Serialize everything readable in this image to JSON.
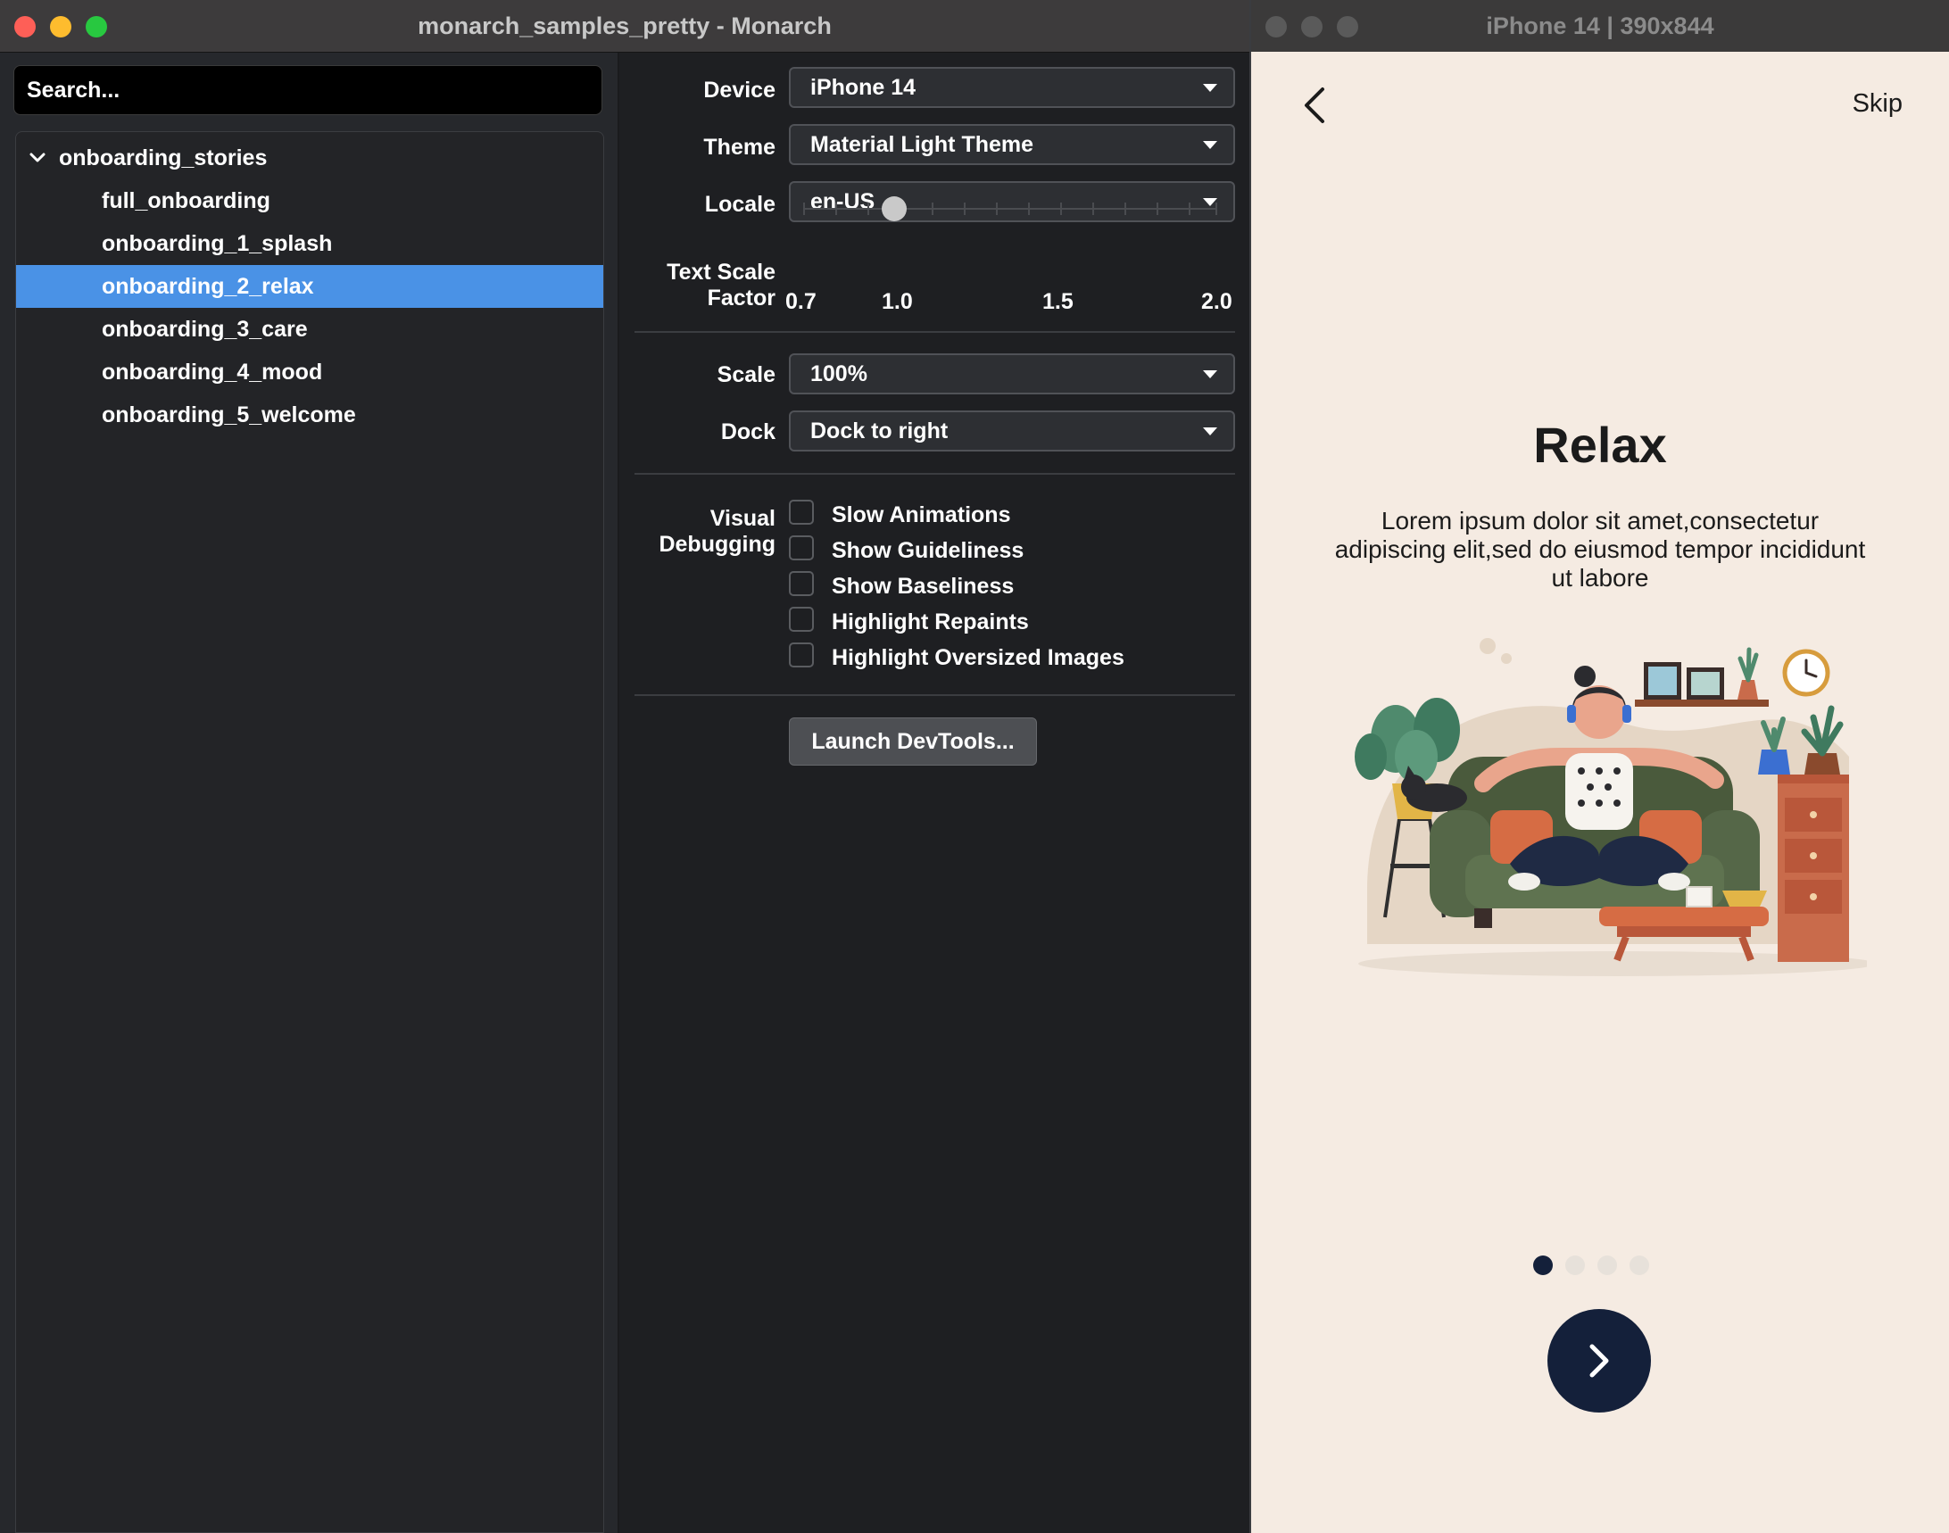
{
  "main_window": {
    "title": "monarch_samples_pretty - Monarch"
  },
  "sidebar": {
    "search_placeholder": "Search...",
    "group": {
      "label": "onboarding_stories",
      "expanded": true
    },
    "items": [
      {
        "label": "full_onboarding",
        "selected": false
      },
      {
        "label": "onboarding_1_splash",
        "selected": false
      },
      {
        "label": "onboarding_2_relax",
        "selected": true
      },
      {
        "label": "onboarding_3_care",
        "selected": false
      },
      {
        "label": "onboarding_4_mood",
        "selected": false
      },
      {
        "label": "onboarding_5_welcome",
        "selected": false
      }
    ]
  },
  "settings": {
    "device": {
      "label": "Device",
      "value": "iPhone 14"
    },
    "theme": {
      "label": "Theme",
      "value": "Material Light Theme"
    },
    "locale": {
      "label": "Locale",
      "value": "en-US"
    },
    "text_scale": {
      "label_line1": "Text Scale",
      "label_line2": "Factor",
      "value": 1.0,
      "tick_labels": [
        "0.7",
        "1.0",
        "1.5",
        "2.0"
      ]
    },
    "scale": {
      "label": "Scale",
      "value": "100%"
    },
    "dock": {
      "label": "Dock",
      "value": "Dock to right"
    },
    "visual_debugging": {
      "label_line1": "Visual",
      "label_line2": "Debugging",
      "options": [
        {
          "label": "Slow Animations",
          "checked": false
        },
        {
          "label": "Show Guideliness",
          "checked": false
        },
        {
          "label": "Show Baseliness",
          "checked": false
        },
        {
          "label": "Highlight Repaints",
          "checked": false
        },
        {
          "label": "Highlight Oversized Images",
          "checked": false
        }
      ]
    },
    "launch_devtools": "Launch DevTools..."
  },
  "device_window": {
    "title": "iPhone 14 | 390x844",
    "skip": "Skip",
    "heading": "Relax",
    "description": "Lorem ipsum dolor sit amet,consectetur adipiscing elit,sed do eiusmod tempor incididunt ut labore",
    "page_indicator": {
      "count": 4,
      "active_index": 0
    }
  },
  "colors": {
    "selection": "#4a92e6",
    "device_bg": "#f5ebe2",
    "navy": "#14203a"
  }
}
